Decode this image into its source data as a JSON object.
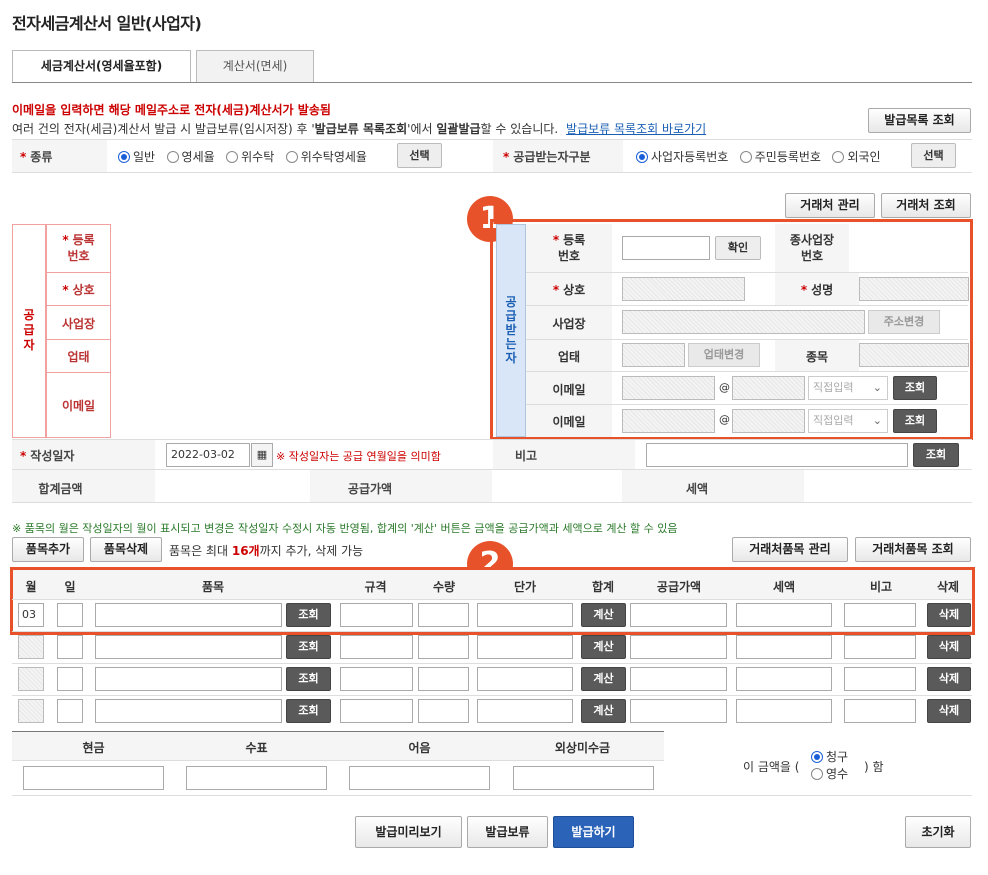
{
  "page_title": "전자세금계산서 일반(사업자)",
  "tabs": [
    "세금계산서(영세율포함)",
    "계산서(면세)"
  ],
  "notice": {
    "line1": "이메일을 입력하면 해당 메일주소로 전자(세금)계산서가 발송됨",
    "line2_a": "여러 건의 전자(세금)계산서 발급 시 발급보류(임시저장) 후 '",
    "line2_b": "발급보류 목록조회",
    "line2_c": "'에서 ",
    "line2_d": "일괄발급",
    "line2_e": "할 수 있습니다.",
    "link": "발급보류 목록조회 바로가기"
  },
  "buttons": {
    "issue_list": "발급목록 조회",
    "select": "선택",
    "partner_manage": "거래처 관리",
    "partner_search": "거래처 조회",
    "confirm": "확인",
    "addr_change": "주소변경",
    "biz_change": "업태변경",
    "search": "조회",
    "item_add": "품목추가",
    "item_delete": "품목삭제",
    "partner_item_manage": "거래처품목 관리",
    "partner_item_search": "거래처품목 조회",
    "calc": "계산",
    "delete": "삭제",
    "preview": "발급미리보기",
    "hold": "발급보류",
    "issue": "발급하기",
    "reset": "초기화"
  },
  "kind": {
    "label": "종류",
    "options": [
      "일반",
      "영세율",
      "위수탁",
      "위수탁영세율"
    ],
    "selected": 0
  },
  "recv_type": {
    "label": "공급받는자구분",
    "options": [
      "사업자등록번호",
      "주민등록번호",
      "외국인"
    ],
    "selected": 0
  },
  "supplier": {
    "title": "공급자",
    "fields": [
      "등록\n번호",
      "상호",
      "사업장",
      "업태",
      "이메일"
    ]
  },
  "receiver": {
    "title": "공급받는자",
    "reg_no": "등록\n번호",
    "sub_biz": "종사업장\n번호",
    "name": "상호",
    "ceo": "성명",
    "addr": "사업장",
    "biz": "업태",
    "item": "종목",
    "email": "이메일",
    "email_at": "@",
    "email_select": "직접입력"
  },
  "write_date": {
    "label": "작성일자",
    "value": "2022-03-02",
    "note": "※ 작성일자는 공급 연월일을 의미함"
  },
  "remark_label": "비고",
  "totals": {
    "total": "합계금액",
    "supply": "공급가액",
    "tax": "세액"
  },
  "item_note": "※ 품목의 월은 작성일자의 월이 표시되고 변경은 작성일자 수정시 자동 반영됨, 합계의 '계산' 버튼은 금액을 공급가액과 세액으로 계산 할 수 있음",
  "item_limit": {
    "a": "품목은 최대 ",
    "b": "16개",
    "c": "까지 추가, 삭제 가능"
  },
  "item_headers": [
    "월",
    "일",
    "품목",
    "규격",
    "수량",
    "단가",
    "합계",
    "공급가액",
    "세액",
    "비고",
    "삭제"
  ],
  "first_row_month": "03",
  "payment": {
    "headers": [
      "현금",
      "수표",
      "어음",
      "외상미수금"
    ],
    "text_a": "이 금액을 (",
    "opt1": "청구",
    "opt2": "영수",
    "text_b": ") 함"
  },
  "badges": [
    "1",
    "2"
  ],
  "colors": {
    "accent": "#e8522a",
    "required": "#cc0000",
    "primary_btn": "#2b63b8"
  }
}
